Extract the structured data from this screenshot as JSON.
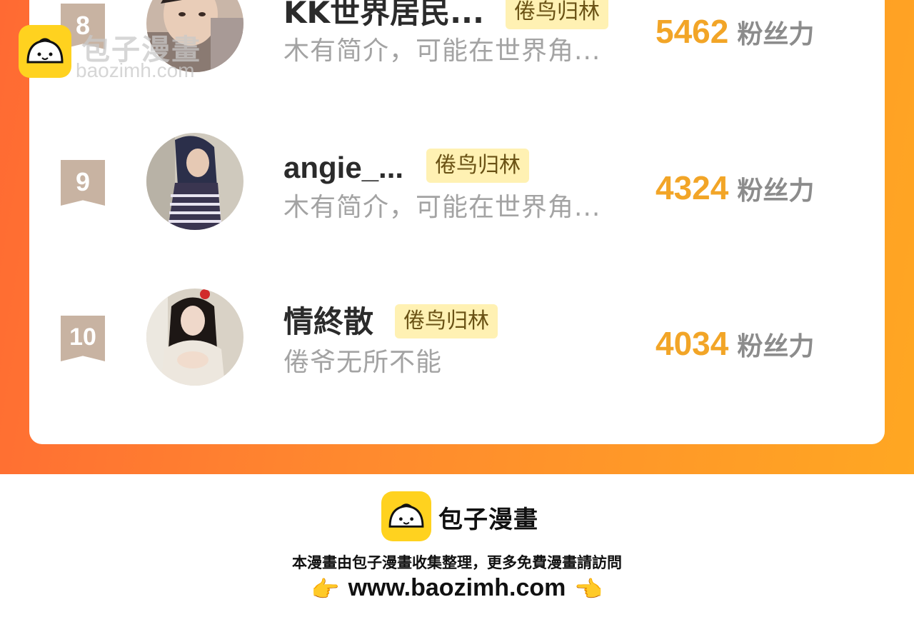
{
  "watermark": {
    "title": "包子漫畫",
    "url": "baozimh.com"
  },
  "ranking": [
    {
      "rank": "8",
      "name": "KK世界居民...",
      "tag": "倦鸟归林",
      "bio": "木有简介，可能在世界角...",
      "fans": "5462",
      "fans_unit": "粉丝力"
    },
    {
      "rank": "9",
      "name": "angie_...",
      "tag": "倦鸟归林",
      "bio": "木有简介，可能在世界角...",
      "fans": "4324",
      "fans_unit": "粉丝力"
    },
    {
      "rank": "10",
      "name": "情終散",
      "tag": "倦鸟归林",
      "bio": "倦爷无所不能",
      "fans": "4034",
      "fans_unit": "粉丝力"
    }
  ],
  "footer": {
    "brand": "包子漫畫",
    "description": "本漫畫由包子漫畫收集整理，更多免費漫畫請訪問",
    "url": "www.baozimh.com",
    "left_hand": "👉",
    "right_hand": "👈"
  },
  "colors": {
    "gradient_start": "#ff6a33",
    "gradient_end": "#ffa722",
    "fans_number": "#f2a527",
    "tag_bg": "#fff1b3",
    "rank_badge": "#c8b3a2",
    "logo_yellow": "#ffd21f"
  },
  "icons": [
    "bun-logo-icon",
    "rank-ribbon-icon",
    "pointing-hand-icon"
  ]
}
